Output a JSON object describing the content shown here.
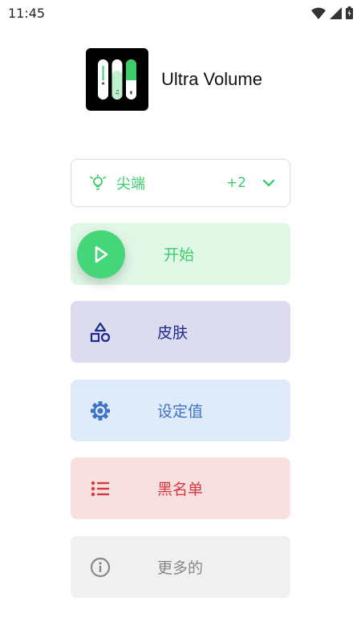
{
  "status_bar": {
    "time": "11:45"
  },
  "app": {
    "title": "Ultra Volume",
    "logo_icon": "volume-sliders-icon"
  },
  "mode_selector": {
    "label": "尖端",
    "count": "+2",
    "icon": "lightbulb-icon",
    "chevron": "chevron-down-icon"
  },
  "menu": {
    "start": {
      "label": "开始",
      "icon": "play-icon",
      "color": "#3ccc6c"
    },
    "skin": {
      "label": "皮肤",
      "icon": "shapes-icon",
      "color": "#1d2a8c"
    },
    "settings": {
      "label": "设定值",
      "icon": "gear-icon",
      "color": "#3d73c7"
    },
    "blacklist": {
      "label": "黑名单",
      "icon": "list-icon",
      "color": "#d5383e"
    },
    "more": {
      "label": "更多的",
      "icon": "info-icon",
      "color": "#888888"
    }
  }
}
